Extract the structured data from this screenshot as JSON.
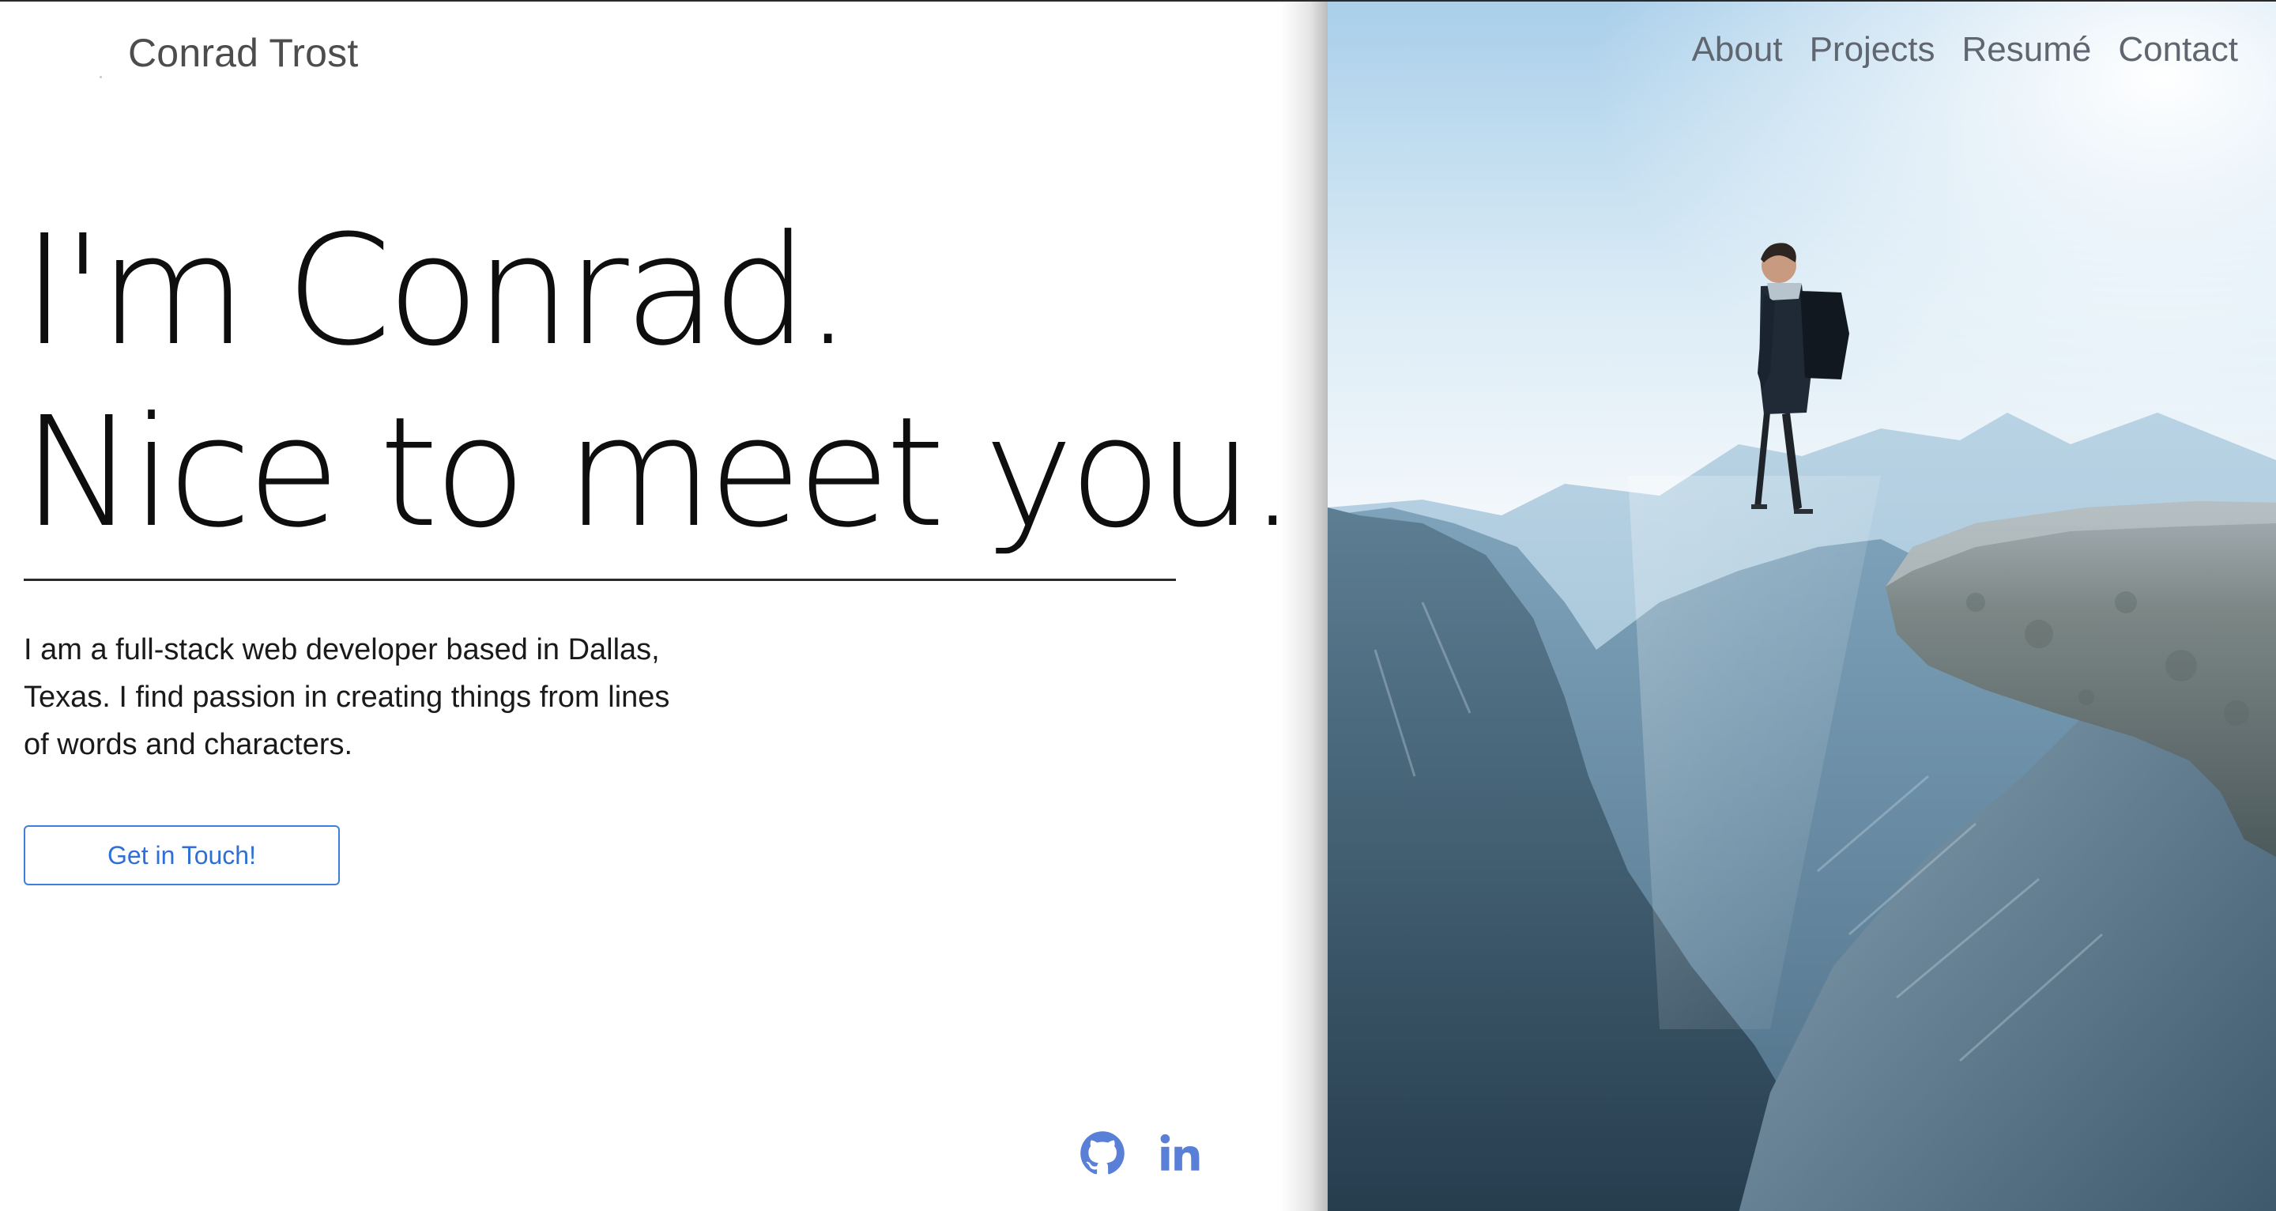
{
  "brand": {
    "name": "Conrad Trost"
  },
  "nav": {
    "items": [
      {
        "label": "About"
      },
      {
        "label": "Projects"
      },
      {
        "label": "Resumé"
      },
      {
        "label": "Contact"
      }
    ]
  },
  "hero": {
    "line1": "I'm Conrad.",
    "line2": "Nice to meet you."
  },
  "bio": {
    "text": "I am a full-stack web developer based in Dallas, Texas. I find passion in creating things from lines of words and characters."
  },
  "cta": {
    "label": "Get in Touch!"
  },
  "social": {
    "github_icon": "github-icon",
    "linkedin_icon": "linkedin-icon"
  },
  "colors": {
    "accent": "#3f7fdc",
    "social_icon": "#5a7fd6",
    "nav_text": "#5f6670",
    "hero_text": "#0e0e0e"
  }
}
